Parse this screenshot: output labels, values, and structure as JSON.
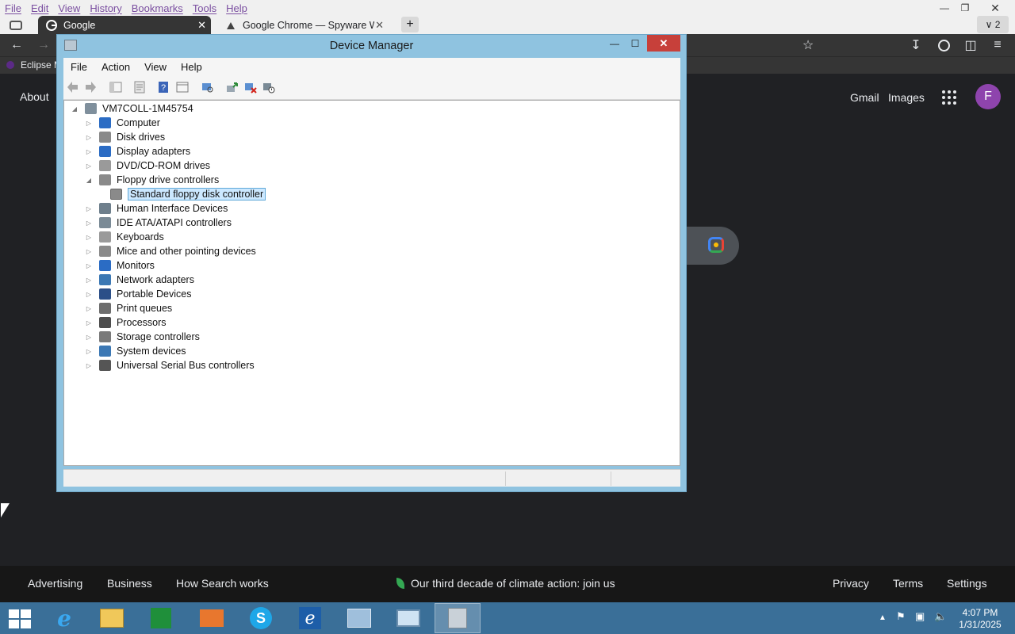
{
  "browser": {
    "menu": [
      "File",
      "Edit",
      "View",
      "History",
      "Bookmarks",
      "Tools",
      "Help"
    ],
    "tabs": [
      {
        "title": "Google",
        "active": true,
        "icon": "google-g-icon"
      },
      {
        "title": "Google Chrome — Spyware Wa",
        "active": false,
        "icon": "spyware-icon"
      }
    ],
    "tab_overflow_count": "2",
    "bookmark": "Eclipse M"
  },
  "google": {
    "about": "About",
    "gmail": "Gmail",
    "images": "Images",
    "avatar_letter": "F",
    "footer": {
      "advertising": "Advertising",
      "business": "Business",
      "how_search_works": "How Search works",
      "climate": "Our third decade of climate action: join us",
      "privacy": "Privacy",
      "terms": "Terms",
      "settings": "Settings"
    }
  },
  "device_manager": {
    "title": "Device Manager",
    "menu": [
      "File",
      "Action",
      "View",
      "Help"
    ],
    "root": "VM7COLL-1M45754",
    "categories": [
      {
        "label": "Computer",
        "color": "#2b6cc4"
      },
      {
        "label": "Disk drives",
        "color": "#8a8a8a"
      },
      {
        "label": "Display adapters",
        "color": "#2b6cc4"
      },
      {
        "label": "DVD/CD-ROM drives",
        "color": "#9a9a9a"
      },
      {
        "label": "Floppy drive controllers",
        "color": "#8a8a8a",
        "expanded": true
      },
      {
        "label": "Human Interface Devices",
        "color": "#6e7f8c"
      },
      {
        "label": "IDE ATA/ATAPI controllers",
        "color": "#7a8a96"
      },
      {
        "label": "Keyboards",
        "color": "#9a9a9a"
      },
      {
        "label": "Mice and other pointing devices",
        "color": "#8a8a8a"
      },
      {
        "label": "Monitors",
        "color": "#2b6cc4"
      },
      {
        "label": "Network adapters",
        "color": "#3c78b4"
      },
      {
        "label": "Portable Devices",
        "color": "#2b4f88"
      },
      {
        "label": "Print queues",
        "color": "#6d6d6d"
      },
      {
        "label": "Processors",
        "color": "#4d4d4d"
      },
      {
        "label": "Storage controllers",
        "color": "#7a7a7a"
      },
      {
        "label": "System devices",
        "color": "#3c78b4"
      },
      {
        "label": "Universal Serial Bus controllers",
        "color": "#555555"
      }
    ],
    "selected_child": "Standard floppy disk controller"
  },
  "taskbar": {
    "clock_time": "4:07 PM",
    "clock_date": "1/31/2025"
  },
  "colors": {
    "window_frame": "#8fc3e0",
    "taskbar": "#3a6f98",
    "close_button": "#c7403a",
    "selection": "#cce8ff"
  }
}
